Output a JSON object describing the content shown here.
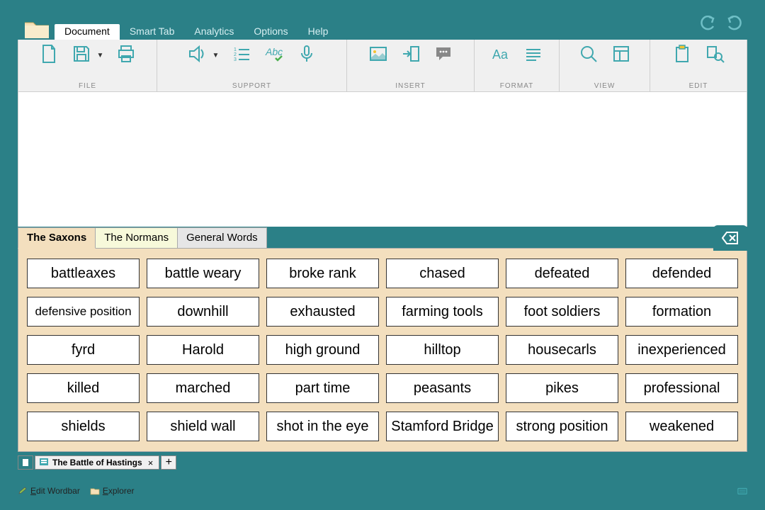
{
  "menu": {
    "tabs": [
      "Document",
      "Smart Tab",
      "Analytics",
      "Options",
      "Help"
    ],
    "active": 0
  },
  "ribbon": {
    "groups": [
      {
        "label": "FILE",
        "icons": [
          "new-file-icon",
          "save-icon",
          "caret",
          "print-icon"
        ]
      },
      {
        "label": "SUPPORT",
        "icons": [
          "speaker-icon",
          "caret",
          "list-icon",
          "spellcheck-icon",
          "mic-icon"
        ]
      },
      {
        "label": "INSERT",
        "icons": [
          "image-icon",
          "insert-right-icon",
          "comment-icon"
        ]
      },
      {
        "label": "FORMAT",
        "icons": [
          "font-icon",
          "lines-icon"
        ]
      },
      {
        "label": "VIEW",
        "icons": [
          "zoom-icon",
          "layout-icon"
        ]
      },
      {
        "label": "EDIT",
        "icons": [
          "paste-icon",
          "find-replace-icon"
        ]
      }
    ]
  },
  "wordbar": {
    "tabs": [
      "The Saxons",
      "The Normans",
      "General Words"
    ],
    "active": 0,
    "words": [
      "battleaxes",
      "battle weary",
      "broke rank",
      "chased",
      "defeated",
      "defended",
      "defensive position",
      "downhill",
      "exhausted",
      "farming tools",
      "foot soldiers",
      "formation",
      "fyrd",
      "Harold",
      "high ground",
      "hilltop",
      "housecarls",
      "inexperienced",
      "killed",
      "marched",
      "part time",
      "peasants",
      "pikes",
      "professional",
      "shields",
      "shield wall",
      "shot in the eye",
      "Stamford Bridge",
      "strong position",
      "weakened"
    ]
  },
  "doc_tabs": {
    "title": "The Battle of Hastings"
  },
  "status": {
    "edit": "Edit Wordbar",
    "explorer": "Explorer"
  }
}
